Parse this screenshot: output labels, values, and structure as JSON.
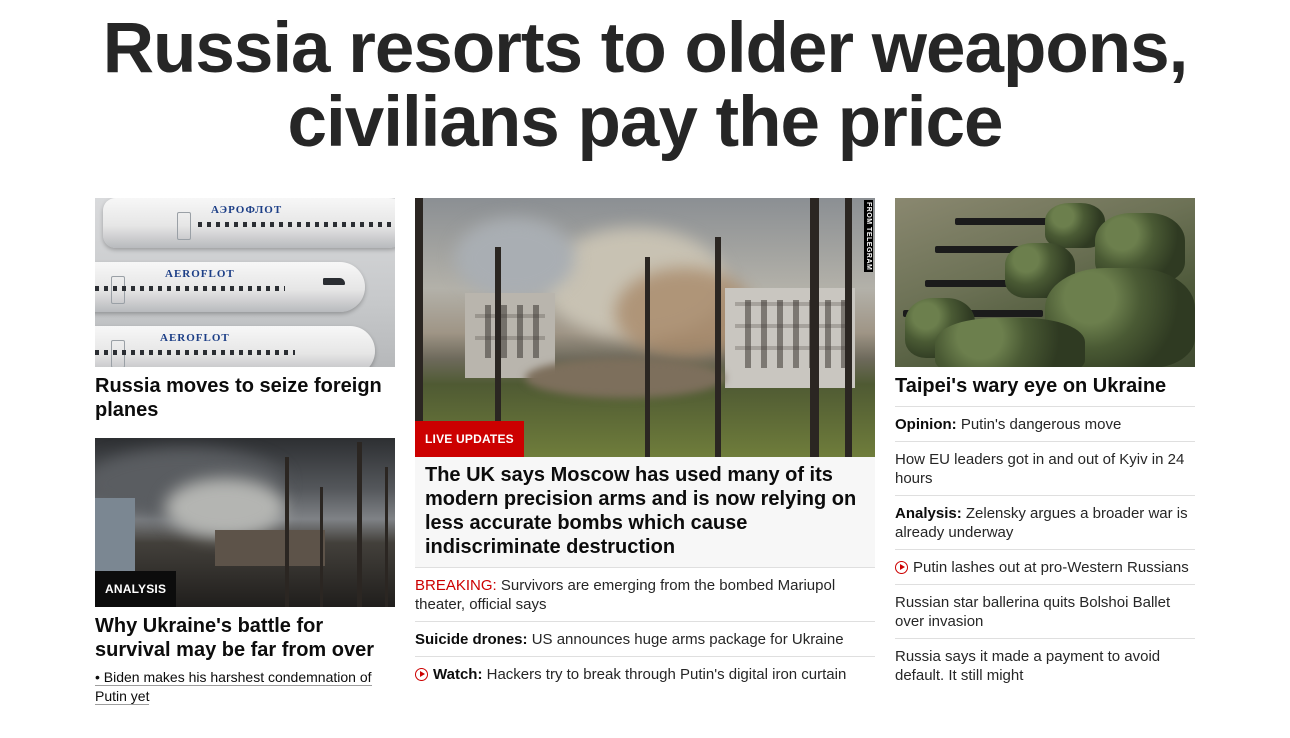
{
  "headline": "Russia resorts to older weapons, civilians pay the price",
  "left": {
    "card1": {
      "image_alt": "Aeroflot planes",
      "plane_labels": [
        "АЭРОФЛОТ",
        "AEROFLOT",
        "AEROFLOT"
      ],
      "title": "Russia moves to seize foreign planes"
    },
    "card2": {
      "label": "ANALYSIS",
      "title": "Why Ukraine's battle for survival may be far from over",
      "sub_link": "• Biden makes his harshest condemnation of Putin yet"
    }
  },
  "middle": {
    "image_credit": "FROM TELEGRAM",
    "label": "LIVE UPDATES",
    "title": "The UK says Moscow has used many of its modern precision arms and is now relying on less accurate bombs which cause indiscriminate destruction",
    "items": [
      {
        "prefix": "BREAKING:",
        "prefix_style": "breaking",
        "text": " Survivors are emerging from the bombed Mariupol theater, official says"
      },
      {
        "prefix": "Suicide drones:",
        "prefix_style": "bold",
        "text": " US announces huge arms package for Ukraine"
      },
      {
        "icon": "play-icon",
        "prefix": "Watch:",
        "prefix_style": "bold",
        "text": " Hackers try to break through Putin's digital iron curtain"
      }
    ]
  },
  "right": {
    "image_alt": "Taiwanese soldiers",
    "title": "Taipei's wary eye on Ukraine",
    "items": [
      {
        "prefix": "Opinion:",
        "text": " Putin's dangerous move"
      },
      {
        "prefix": "",
        "text": "How EU leaders got in and out of Kyiv in 24 hours"
      },
      {
        "prefix": "Analysis:",
        "text": " Zelensky argues a broader war is already underway"
      },
      {
        "icon": "play-icon",
        "prefix": "",
        "text": "Putin lashes out at pro-Western Russians"
      },
      {
        "prefix": "",
        "text": "Russian star ballerina quits Bolshoi Ballet over invasion"
      },
      {
        "prefix": "",
        "text": "Russia says it made a payment to avoid default. It still might"
      }
    ]
  },
  "colors": {
    "accent_red": "#cc0000",
    "text": "#0c0c0c",
    "divider": "#dfdfdf"
  }
}
